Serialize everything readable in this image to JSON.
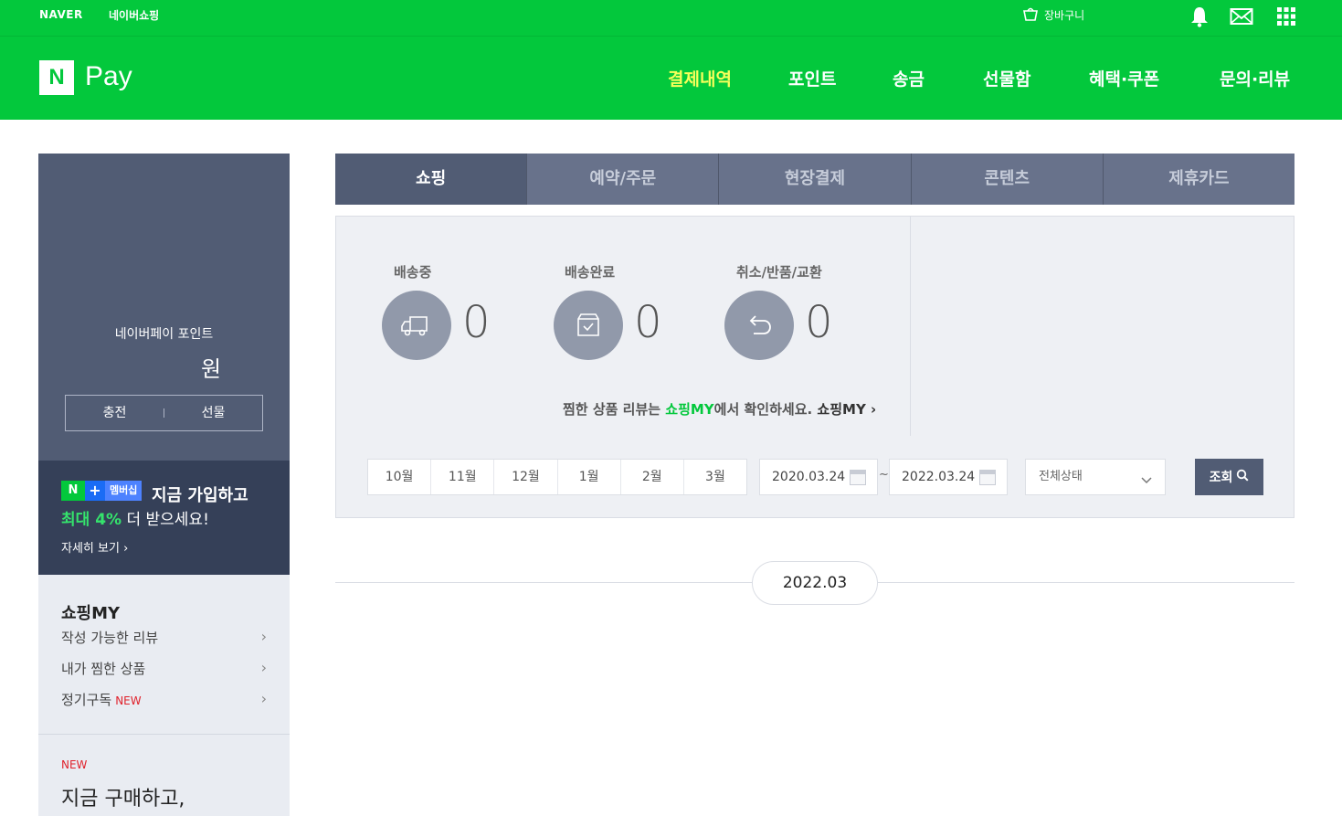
{
  "topbar": {
    "naver": "NAVER",
    "shopping": "네이버쇼핑",
    "cart": "장바구니",
    "icons": [
      "bell-icon",
      "mail-icon",
      "apps-grid-icon"
    ]
  },
  "header": {
    "logo_n": "N",
    "logo_pay": "Pay",
    "nav": [
      "결제내역",
      "포인트",
      "송금",
      "선물함",
      "혜택·쿠폰",
      "문의·리뷰"
    ],
    "active_nav": "결제내역",
    "active_color": "#f7ff5a",
    "brand_color": "#03c83c"
  },
  "sidebar": {
    "points_label": "네이버페이 포인트",
    "points_unit": "원",
    "charge": "충전",
    "gift": "선물",
    "membership": {
      "badge_n": "N",
      "badge_plus": "+",
      "badge_word": "멤버십",
      "line1": "지금 가입하고",
      "line2_highlight": "최대 4%",
      "line2_rest": " 더 받으세요!",
      "more": "자세히 보기 ›"
    },
    "shopping_my": {
      "title": "쇼핑MY",
      "items": [
        {
          "label": "작성 가능한 리뷰"
        },
        {
          "label": "내가 찜한 상품"
        },
        {
          "label": "정기구독",
          "badge": "NEW"
        }
      ]
    },
    "promo": {
      "badge": "NEW",
      "text": "지금 구매하고,"
    }
  },
  "tabs": [
    "쇼핑",
    "예약/주문",
    "현장결제",
    "콘텐츠",
    "제휴카드"
  ],
  "status": {
    "items": [
      {
        "label": "배송중",
        "count": "0",
        "icon": "truck-icon"
      },
      {
        "label": "배송완료",
        "count": "0",
        "icon": "box-check-icon"
      },
      {
        "label": "취소/반품/교환",
        "count": "0",
        "icon": "return-arrow-icon"
      }
    ],
    "review_prefix": "찜한 상품 리뷰는 ",
    "review_green": "쇼핑MY",
    "review_mid": "에서 확인하세요. ",
    "review_link": "쇼핑MY ›"
  },
  "filter": {
    "months": [
      "10월",
      "11월",
      "12월",
      "1월",
      "2월",
      "3월"
    ],
    "date_from": "2020.03.24",
    "date_sep": "~",
    "date_to": "2022.03.24",
    "status_select": "전체상태",
    "search_label": "조회"
  },
  "list": {
    "month_header": "2022.03"
  }
}
